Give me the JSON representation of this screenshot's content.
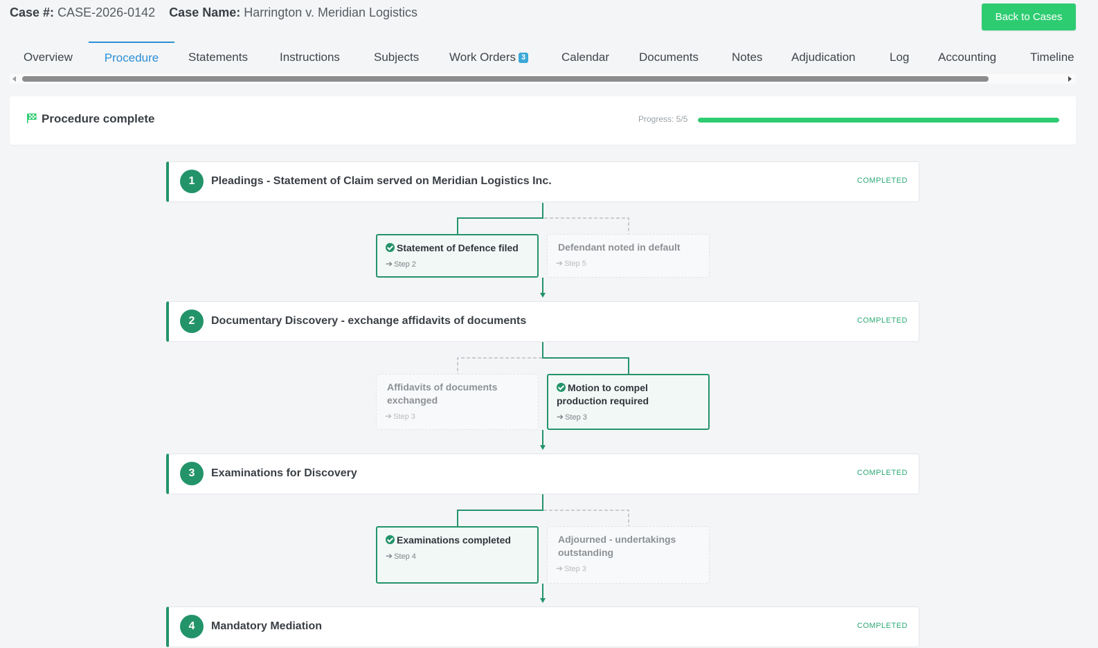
{
  "header": {
    "case_number_label": "Case #:",
    "case_number": "CASE-2026-0142",
    "case_name_label": "Case Name:",
    "case_name": "Harrington v. Meridian Logistics",
    "back_button": "Back to Cases"
  },
  "tabs": [
    {
      "label": "Overview"
    },
    {
      "label": "Procedure",
      "active": true
    },
    {
      "label": "Statements"
    },
    {
      "label": "Instructions"
    },
    {
      "label": "Subjects"
    },
    {
      "label": "Work Orders",
      "badge": "3"
    },
    {
      "label": "Calendar"
    },
    {
      "label": "Documents"
    },
    {
      "label": "Notes"
    },
    {
      "label": "Adjudication"
    },
    {
      "label": "Log"
    },
    {
      "label": "Accounting"
    },
    {
      "label": "Timeline"
    }
  ],
  "status": {
    "title": "Procedure complete",
    "progress_label": "Progress: 5/5",
    "progress_fraction": 1.0,
    "icon": "checkered-flag-icon"
  },
  "colors": {
    "accent_green": "#23936a",
    "progress_green": "#2ecc71",
    "active_tab_blue": "#2b8fd6"
  },
  "steps": [
    {
      "number": "1",
      "title": "Pleadings - Statement of Claim served on Meridian Logistics Inc.",
      "status": "COMPLETED",
      "branches": [
        {
          "label": "Statement of Defence filed",
          "goto": "Step 2",
          "chosen": true
        },
        {
          "label": "Defendant noted in default",
          "goto": "Step 5",
          "chosen": false
        }
      ]
    },
    {
      "number": "2",
      "title": "Documentary Discovery - exchange affidavits of documents",
      "status": "COMPLETED",
      "branches": [
        {
          "label": "Affidavits of documents exchanged",
          "goto": "Step 3",
          "chosen": false
        },
        {
          "label": "Motion to compel production required",
          "goto": "Step 3",
          "chosen": true
        }
      ]
    },
    {
      "number": "3",
      "title": "Examinations for Discovery",
      "status": "COMPLETED",
      "branches": [
        {
          "label": "Examinations completed",
          "goto": "Step 4",
          "chosen": true
        },
        {
          "label": "Adjourned - undertakings outstanding",
          "goto": "Step 3",
          "chosen": false
        }
      ]
    },
    {
      "number": "4",
      "title": "Mandatory Mediation",
      "status": "COMPLETED",
      "branches": []
    }
  ]
}
